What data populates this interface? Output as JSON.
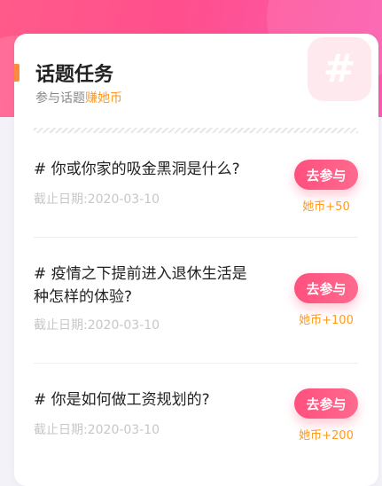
{
  "header": {
    "title": "话题任务",
    "subtitle_prefix": "参与话题",
    "subtitle_highlight": "赚她币",
    "decor_glyph": "#"
  },
  "tasks": [
    {
      "title": "# 你或你家的吸金黑洞是什么?",
      "date": "截止日期:2020-03-10",
      "button": "去参与",
      "reward": "她币+50"
    },
    {
      "title": "# 疫情之下提前进入退休生活是种怎样的体验?",
      "date": "截止日期:2020-03-10",
      "button": "去参与",
      "reward": "她币+100"
    },
    {
      "title": "# 你是如何做工资规划的?",
      "date": "截止日期:2020-03-10",
      "button": "去参与",
      "reward": "她币+200"
    }
  ],
  "colors": {
    "accent_pink": "#ff4f7e",
    "reward_orange": "#ff9a1f",
    "title_bar_orange": "#ff8a3d"
  },
  "icons": [
    "hash-icon"
  ]
}
